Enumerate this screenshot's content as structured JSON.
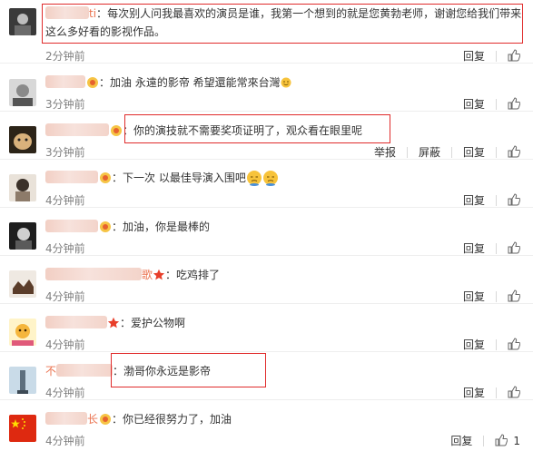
{
  "comments": [
    {
      "user_tail": "ti",
      "text": "每次别人问我最喜欢的演员是谁，我第一个想到的就是您黄勃老师，谢谢您给我们带来",
      "text2": "这么多好看的影视作品。",
      "time": "2分钟前",
      "reply": "回复"
    },
    {
      "text": "加油 永遠的影帝 希望還能常來台灣",
      "time": "3分钟前",
      "reply": "回复"
    },
    {
      "text": "你的演技就不需要奖项证明了，观众看在眼里呢",
      "time": "3分钟前",
      "report": "举报",
      "block": "屏蔽",
      "reply": "回复"
    },
    {
      "text": "下一次 以最佳导演入围吧",
      "time": "4分钟前",
      "reply": "回复"
    },
    {
      "text": "加油，你是最棒的",
      "time": "4分钟前",
      "reply": "回复"
    },
    {
      "user_tail": "歌",
      "text": "吃鸡排了",
      "time": "4分钟前",
      "reply": "回复"
    },
    {
      "text": "爱护公物啊",
      "time": "4分钟前",
      "reply": "回复"
    },
    {
      "user_tail": "不",
      "text": "渤哥你永远是影帝",
      "time": "4分钟前",
      "reply": "回复"
    },
    {
      "user_tail": "长",
      "text": "你已经很努力了，加油",
      "time": "4分钟前",
      "reply": "回复",
      "likes": "1"
    }
  ],
  "colors": {
    "username": "#eb7350",
    "highlight_box": "#e02b2b",
    "time": "#808080"
  },
  "icons": {
    "like": "thumbs-up-icon",
    "vip": "vip-badge-icon",
    "star": "star-icon",
    "emoji": "pensive-face-emoji"
  }
}
